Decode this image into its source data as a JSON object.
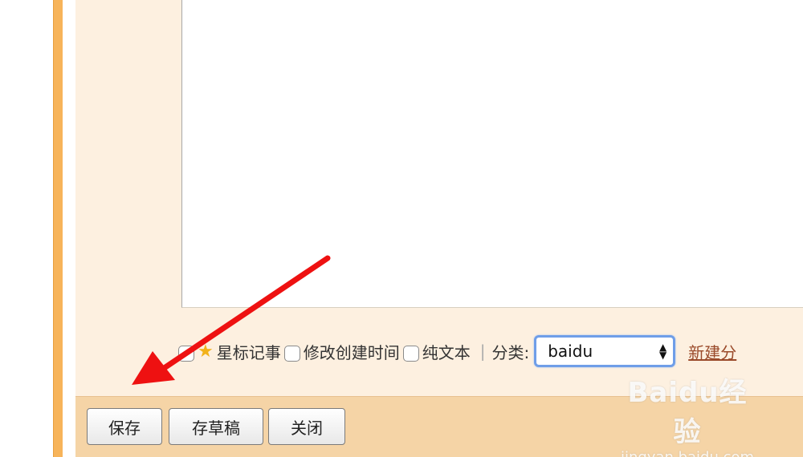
{
  "options": {
    "star_label": "星标记事",
    "modify_time_label": "修改创建时间",
    "plain_text_label": "纯文本",
    "separator": "|",
    "category_label": "分类:",
    "category_selected": "baidu",
    "new_category_link": "新建分"
  },
  "buttons": {
    "save": "保存",
    "draft": "存草稿",
    "close": "关闭"
  },
  "watermark": {
    "logo": "Baidu经验",
    "url": "jingyan.baidu.com"
  },
  "colors": {
    "accent_orange": "#f7b45a",
    "cream": "#fdf0e0",
    "button_bar": "#f5d4a6",
    "arrow_red": "#ee1111",
    "link": "#9a4a2a"
  }
}
